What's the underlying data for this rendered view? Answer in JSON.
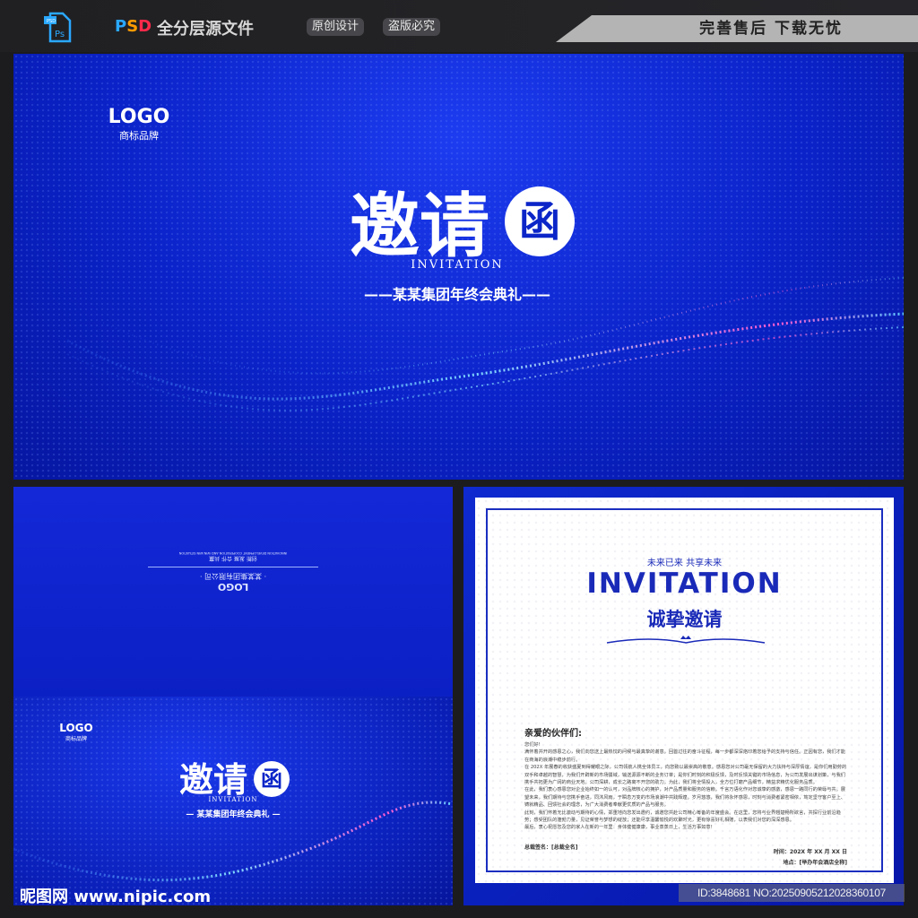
{
  "header": {
    "psd_letters": [
      "P",
      "S",
      "D"
    ],
    "title": "全分层源文件",
    "tags": [
      "原创设计",
      "盗版必究"
    ],
    "slogan": "完善售后 下载无忧",
    "ps_icon_text": "Ps",
    "psd_icon_text": "PSD"
  },
  "banner": {
    "logo": "LOGO",
    "logo_sub": "商标品牌",
    "title": "邀请",
    "seal": "函",
    "subtitle_en": "INVITATION",
    "event": "——某某集团年终会典礼——"
  },
  "back_cover": {
    "logo": "LOGO",
    "company": "· 某某集团有限公司 ·",
    "values": "创新  发展  合作  共赢",
    "values_en": "INNOVATION DEVELOPMENT COOPERATION AND WIN-WIN SITUATION"
  },
  "front_cover": {
    "logo": "LOGO",
    "logo_sub": "商标品牌",
    "title": "邀请",
    "seal": "函",
    "subtitle_en": "INVITATION",
    "event": "— 某某集团年终会典礼 —"
  },
  "letter": {
    "slogan": "未来已来    共享未来",
    "title_en": "INVITATION",
    "title_cn": "诚挚邀请",
    "greeting": "亲爱的伙伴们:",
    "paragraphs": [
      "您们好!",
      "满怀着并开的感恩之心，我们向您送上最热忱的问候与最真挚的谢意。回首过往的奋斗征程，每一步都深深烙印着您给予的支持与信任。正因有您，我们才能在商海的浪潮中稳步前行。",
      "在 202X 年展春的收获盛夏到得耀眼之际，公司领航人携全体员工，向您致以最崇高的敬意。感恩您对公司毫无保留的大力扶持与深厚情谊，是你们用勤劳的双手和卓越的智慧，为我们开辟新的市场疆域，输送源源不断的业务订单；是你们时刻的积极反馈，及时反馈关键的市场信息，为公司发展出谋划策，与我们携手共拓更为广阔的商业天地。公司深耕，成长之路离不开您的助力。为此，我们将全情投入，全方位打磨产品细节，精益求精优化服务品质。",
      "在此，我们衷心感恩您对企业始终如一的认可，对品牌核心的拥护，对产品质量和服务的信赖。千言万语化作对您诚挚的感激，感恩一路同行的荣辱与共。展望未来，我们期待与您携手奋进，同沐风雨，于瞬息万变的市场浪潮中共践辉煌。岁月悠悠，我们将永怀感恩，时刻与消费者紧密相依，笃定坚守客户至上、铸就精品、回馈社会的理念，为广大消费者奉献更优质的产品与服务。",
      "此刻，我们怀着无比激动与期待的心情，郑重地向您发出邀约，诚邀您共赴公司精心筹备的年度盛会。在这里，您将与业界翘楚畅所欲言，共探行业前沿趋势；感受团队的蓬勃力量，见证荣誉与梦想的绽放；还能尽享温馨愉悦的欢聚时光，更有惊喜好礼相赠，以表我们对您的深深感恩。",
      "最后，衷心祝愿您及您的家人在新的一年里：身体健健康康，事业蒸蒸日上，生活万事如意！"
    ],
    "signature": "总裁签名：[总裁全名]",
    "time": "时间：202X 年 XX 月 XX 日",
    "place": "地点：[举办年会酒店全称]"
  },
  "footer": {
    "watermark": "昵图网 www.nipic.com",
    "id": "ID:3848681 NO:20250905212028360107"
  }
}
